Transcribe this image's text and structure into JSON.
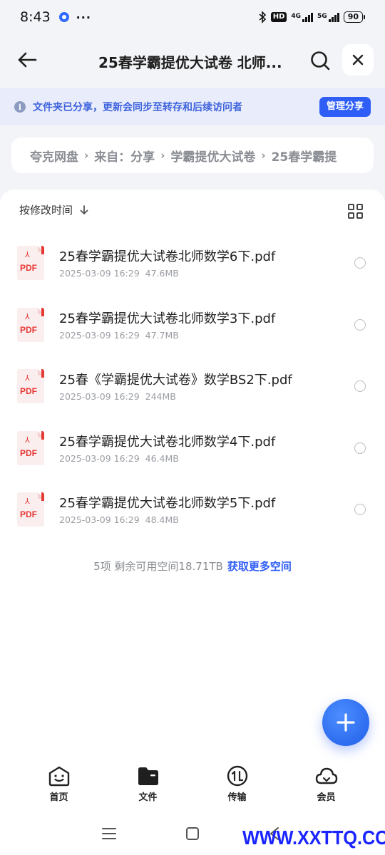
{
  "status_bar": {
    "time": "8:43",
    "more": "···",
    "hd": "HD",
    "net1": "4G",
    "net2": "5G",
    "battery": "90"
  },
  "header": {
    "title": "25春学霸提优大试卷 北师..."
  },
  "notice": {
    "text": "文件夹已分享，更新会同步至转存和后续访问者",
    "button": "管理分享"
  },
  "breadcrumb": {
    "items": [
      "夸克网盘",
      "来自：分享",
      "学霸提优大试卷",
      "25春学霸提"
    ]
  },
  "sort": {
    "label": "按修改时间"
  },
  "files": [
    {
      "name": "25春学霸提优大试卷北师数学6下.pdf",
      "date": "2025-03-09 16:29",
      "size": "47.6MB",
      "icon_label": "PDF"
    },
    {
      "name": "25春学霸提优大试卷北师数学3下.pdf",
      "date": "2025-03-09 16:29",
      "size": "47.7MB",
      "icon_label": "PDF"
    },
    {
      "name": "25春《学霸提优大试卷》数学BS2下.pdf",
      "date": "2025-03-09 16:29",
      "size": "244MB",
      "icon_label": "PDF"
    },
    {
      "name": "25春学霸提优大试卷北师数学4下.pdf",
      "date": "2025-03-09 16:29",
      "size": "46.4MB",
      "icon_label": "PDF"
    },
    {
      "name": "25春学霸提优大试卷北师数学5下.pdf",
      "date": "2025-03-09 16:29",
      "size": "48.4MB",
      "icon_label": "PDF"
    }
  ],
  "footer": {
    "info": "5项 剩余可用空间18.71TB",
    "link": "获取更多空间"
  },
  "nav": {
    "home": "首页",
    "files": "文件",
    "transfer": "传输",
    "member": "会员"
  },
  "watermark": "WWW.XXTTQ.COM",
  "colors": {
    "accent": "#2f5ef7",
    "notice_bg": "#e8ecfb",
    "pdf_red": "#e53935"
  }
}
